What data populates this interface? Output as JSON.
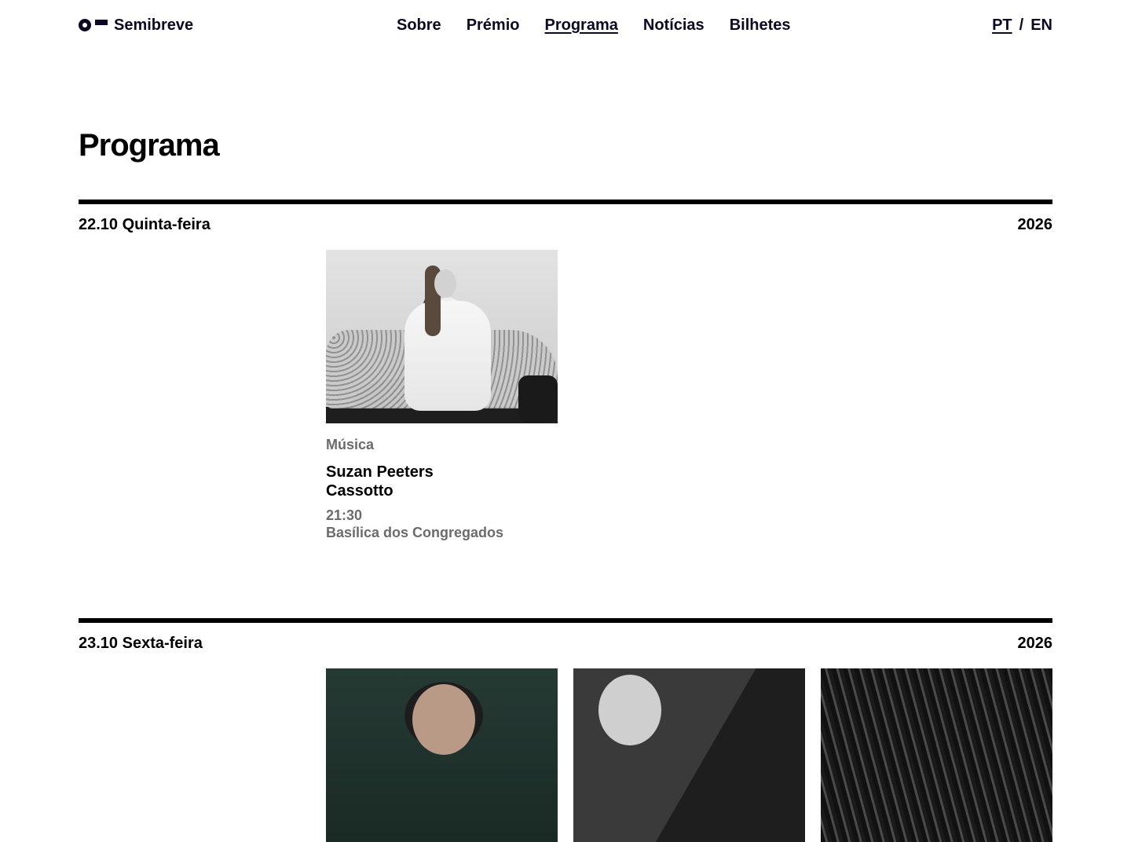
{
  "header": {
    "brand": "Semibreve",
    "nav": [
      {
        "label": "Sobre",
        "active": false
      },
      {
        "label": "Prémio",
        "active": false
      },
      {
        "label": "Programa",
        "active": true
      },
      {
        "label": "Notícias",
        "active": false
      },
      {
        "label": "Bilhetes",
        "active": false
      }
    ],
    "languages": {
      "pt": "PT",
      "separator": "/",
      "en": "EN",
      "active": "PT"
    }
  },
  "page": {
    "title": "Programa"
  },
  "days": [
    {
      "date": "22.10 Quinta-feira",
      "year": "2026",
      "events": [
        {
          "category": "Música",
          "artist": "Suzan Peeters",
          "work": "Cassotto",
          "time": "21:30",
          "venue": "Basílica dos Congregados"
        }
      ]
    },
    {
      "date": "23.10 Sexta-feira",
      "year": "2026"
    }
  ],
  "colors": {
    "text": "#0a0a23",
    "muted": "#6b6b6b",
    "rule": "#000000",
    "background": "#ffffff"
  }
}
